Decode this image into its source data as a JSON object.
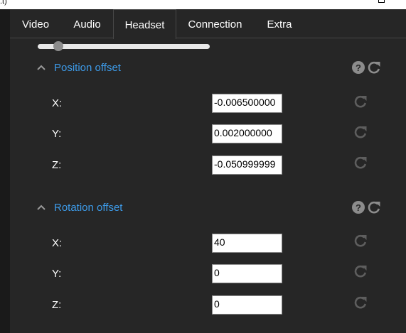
{
  "window": {
    "title_fragment": ".t)"
  },
  "tabs": [
    {
      "label": "Video"
    },
    {
      "label": "Audio"
    },
    {
      "label": "Headset"
    },
    {
      "label": "Connection"
    },
    {
      "label": "Extra"
    }
  ],
  "active_tab": "Headset",
  "slider": {
    "value_fraction": 0.1
  },
  "sections": {
    "position_offset": {
      "title": "Position offset",
      "fields": [
        {
          "label": "X:",
          "value": "-0.006500000"
        },
        {
          "label": "Y:",
          "value": "0.002000000"
        },
        {
          "label": "Z:",
          "value": "-0.050999999"
        }
      ]
    },
    "rotation_offset": {
      "title": "Rotation offset",
      "fields": [
        {
          "label": "X:",
          "value": "40"
        },
        {
          "label": "Y:",
          "value": "0"
        },
        {
          "label": "Z:",
          "value": "0"
        }
      ]
    }
  },
  "colors": {
    "background": "#262626",
    "accent": "#3d9be9",
    "icon": "#8c8c8c"
  },
  "icons": {
    "help": "question-circle-icon",
    "reset": "reset-arrow-icon",
    "collapse": "chevron-up-icon"
  }
}
